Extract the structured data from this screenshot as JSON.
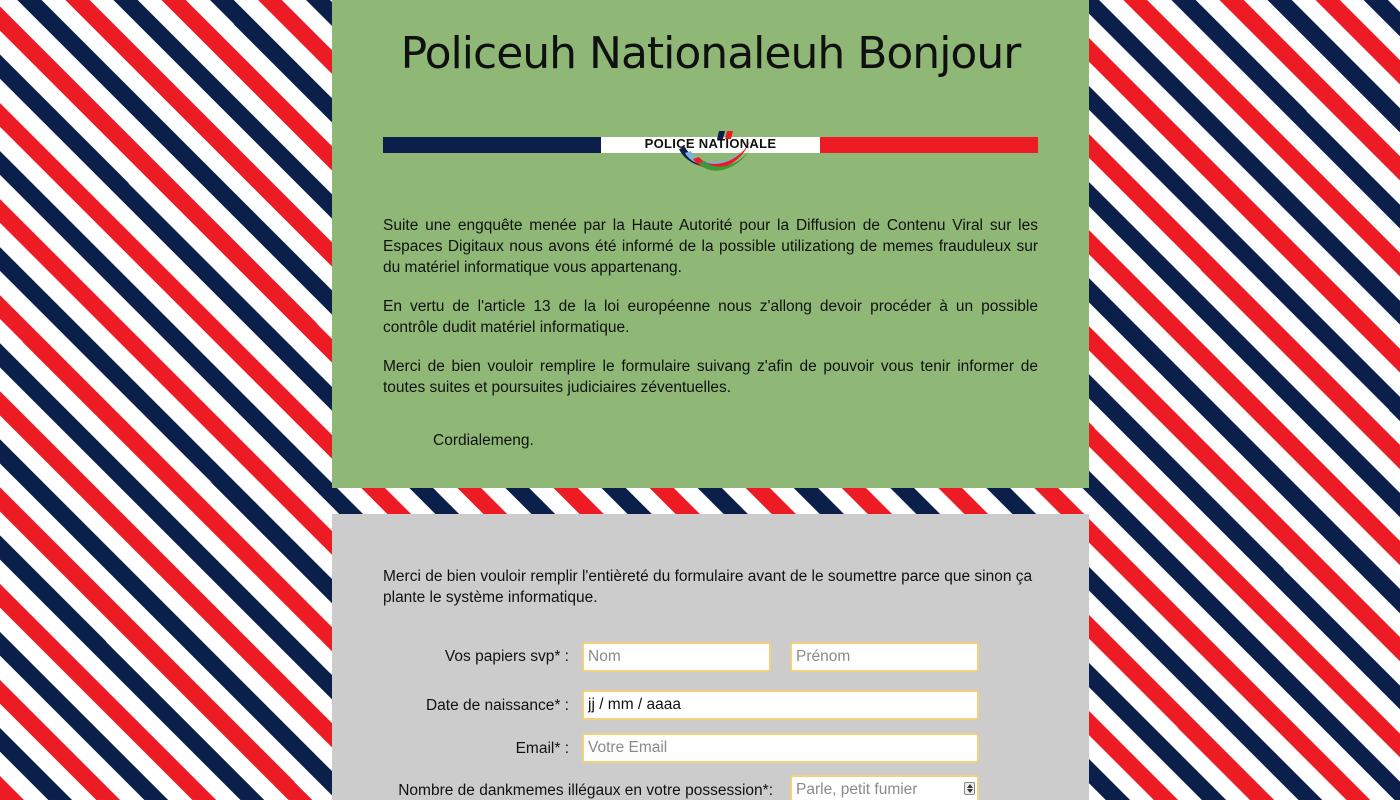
{
  "header": {
    "title": "Policeuh Nationaleuh Bonjour",
    "logo_text": "POLICE NATIONALE"
  },
  "intro": {
    "paragraphs": [
      "Suite une engquête menée par la Haute Autorité pour la Diffusion de Contenu Viral sur les Espaces Digitaux nous avons été informé de la possible utilizationg de memes frauduleux sur du matériel informatique vous appartenang.",
      "En vertu de l'article 13 de la loi européenne nous z'allong devoir procéder à un possible contrôle dudit matériel informatique.",
      "Merci de bien vouloir remplire le formulaire suivang z'afin de pouvoir vous tenir informer de toutes suites et poursuites judiciaires zéventuelles."
    ],
    "signoff": "Cordialemeng."
  },
  "form": {
    "intro": "Merci de bien vouloir remplir l'entièreté du formulaire avant de le soumettre parce que sinon ça plante le système informatique.",
    "papers_label": "Vos papiers svp* :",
    "nom_placeholder": "Nom",
    "prenom_placeholder": "Prénom",
    "birthdate_label": "Date de naissance* :",
    "birthdate_value": "jj / mm / aaaa",
    "email_label": "Email* :",
    "email_placeholder": "Votre Email",
    "memes_label": "Nombre de dankmemes illégaux en votre possession*:",
    "memes_placeholder": "Parle, petit fumier"
  },
  "colors": {
    "red": "#ed1c24",
    "white": "#ffffff",
    "blue": "#0b1f4b",
    "top_card": "#8fb877",
    "form_card": "#cccccc",
    "input_border": "#f1d27a"
  },
  "icons": {
    "logo": "police-nationale-logo",
    "spinner": "number-spinner-icon"
  }
}
